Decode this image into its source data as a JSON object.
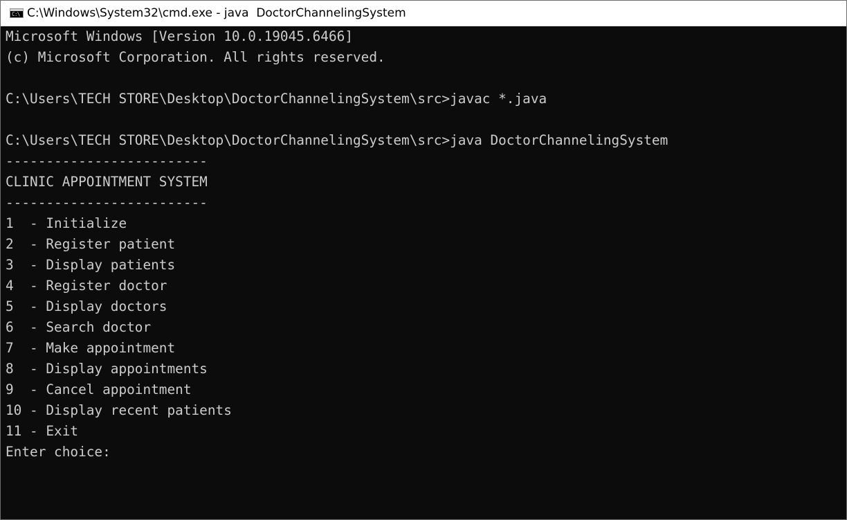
{
  "window": {
    "title": "C:\\Windows\\System32\\cmd.exe - java  DoctorChannelingSystem",
    "icon": "cmd-icon",
    "icon_glyph": "C:\\"
  },
  "console": {
    "text_color": "#cccccc",
    "background": "#0c0c0c",
    "lines": [
      "Microsoft Windows [Version 10.0.19045.6466]",
      "(c) Microsoft Corporation. All rights reserved.",
      "",
      "C:\\Users\\TECH STORE\\Desktop\\DoctorChannelingSystem\\src>javac *.java",
      "",
      "C:\\Users\\TECH STORE\\Desktop\\DoctorChannelingSystem\\src>java DoctorChannelingSystem",
      "-------------------------",
      "CLINIC APPOINTMENT SYSTEM",
      "-------------------------",
      "1  - Initialize",
      "2  - Register patient",
      "3  - Display patients",
      "4  - Register doctor",
      "5  - Display doctors",
      "6  - Search doctor",
      "7  - Make appointment",
      "8  - Display appointments",
      "9  - Cancel appointment",
      "10 - Display recent patients",
      "11 - Exit",
      "Enter choice:"
    ]
  }
}
